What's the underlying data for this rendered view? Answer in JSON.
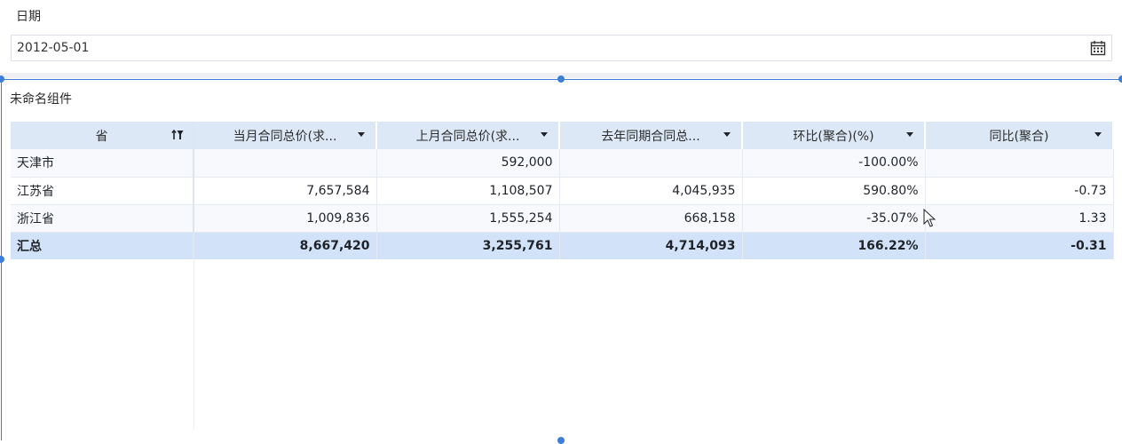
{
  "filter": {
    "label": "日期",
    "date_value": "2012-05-01",
    "icon": "calendar-icon"
  },
  "component": {
    "title": "未命名组件"
  },
  "table": {
    "columns": [
      {
        "label": "省",
        "icon": "sort-filter-icon"
      },
      {
        "label": "当月合同总价(求...",
        "icon": "caret-down-icon"
      },
      {
        "label": "上月合同总价(求...",
        "icon": "caret-down-icon"
      },
      {
        "label": "去年同期合同总...",
        "icon": "caret-down-icon"
      },
      {
        "label": "环比(聚合)(%)",
        "icon": "caret-down-icon"
      },
      {
        "label": "同比(聚合)",
        "icon": "caret-down-icon"
      }
    ],
    "rows": [
      [
        "天津市",
        "",
        "592,000",
        "",
        "-100.00%",
        ""
      ],
      [
        "江苏省",
        "7,657,584",
        "1,108,507",
        "4,045,935",
        "590.80%",
        "-0.73"
      ],
      [
        "浙江省",
        "1,009,836",
        "1,555,254",
        "668,158",
        "-35.07%",
        "1.33"
      ]
    ],
    "total": [
      "汇总",
      "8,667,420",
      "3,255,761",
      "4,714,093",
      "166.22%",
      "-0.31"
    ]
  },
  "colors": {
    "accent": "#3d7fd8",
    "header_bg": "#dde8f7",
    "total_bg": "#d2e2f8"
  }
}
